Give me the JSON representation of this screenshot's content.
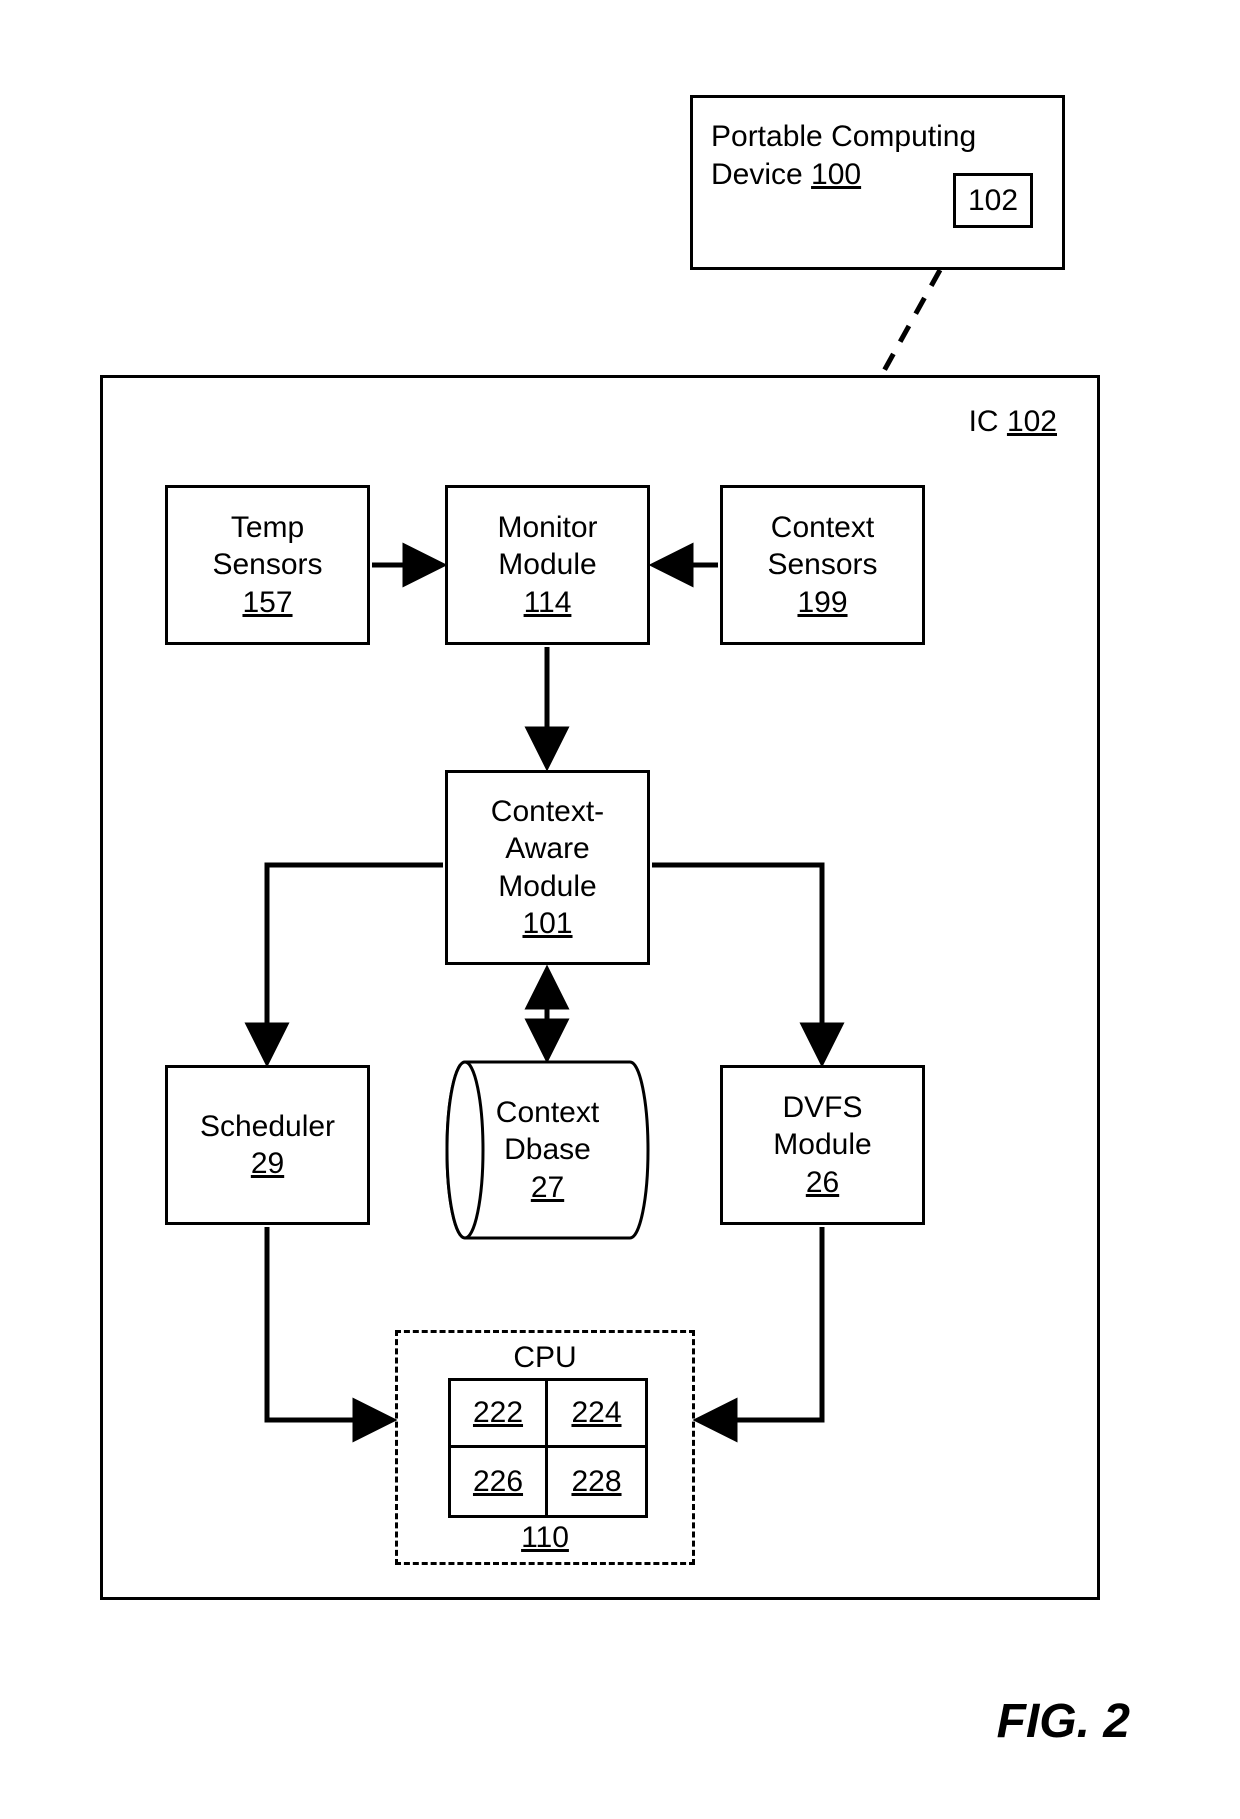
{
  "figure_caption": "FIG.  2",
  "pcd": {
    "title": "Portable Computing\nDevice",
    "ref": "100",
    "inner_ref": "102"
  },
  "ic": {
    "title": "IC",
    "ref": "102"
  },
  "temp_sensors": {
    "t1": "Temp",
    "t2": "Sensors",
    "ref": "157"
  },
  "monitor_module": {
    "t1": "Monitor",
    "t2": "Module",
    "ref": "114"
  },
  "context_sensors": {
    "t1": "Context",
    "t2": "Sensors",
    "ref": "199"
  },
  "context_aware": {
    "t1": "Context-",
    "t2": "Aware",
    "t3": "Module",
    "ref": "101"
  },
  "scheduler": {
    "t1": "Scheduler",
    "ref": "29"
  },
  "context_dbase": {
    "t1": "Context",
    "t2": "Dbase",
    "ref": "27"
  },
  "dvfs": {
    "t1": "DVFS",
    "t2": "Module",
    "ref": "26"
  },
  "cpu": {
    "title": "CPU",
    "ref": "110",
    "cores": {
      "a": "222",
      "b": "224",
      "c": "226",
      "d": "228"
    }
  }
}
